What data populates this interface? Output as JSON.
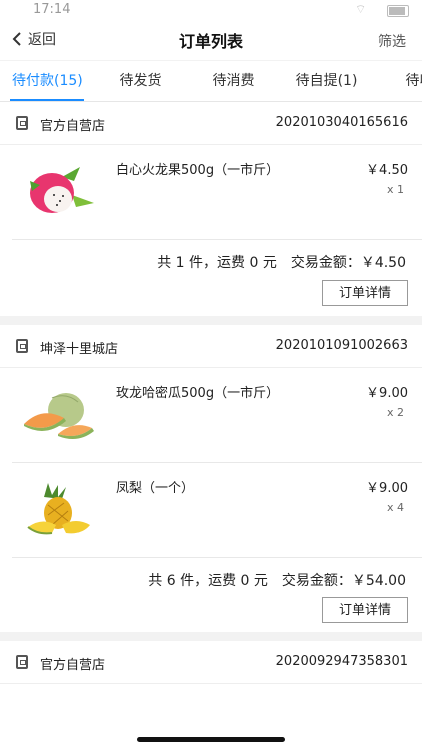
{
  "status": {
    "time": "17:14"
  },
  "navbar": {
    "back_label": "返回",
    "title": "订单列表",
    "filter_label": "筛选"
  },
  "tabs": [
    {
      "label": "待付款(15)"
    },
    {
      "label": "待发货"
    },
    {
      "label": "待消费"
    },
    {
      "label": "待自提(1)"
    },
    {
      "label": "待收"
    }
  ],
  "orders": [
    {
      "store": "官方自营店",
      "order_no": "2020103040165616",
      "items": [
        {
          "name": "白心火龙果500g（一市斤）",
          "price": "￥4.50",
          "qty": "x 1"
        }
      ],
      "summary": {
        "count_text": "共 1 件，运费 0 元",
        "amount_text": "交易金额：￥4.50"
      },
      "detail_label": "订单详情"
    },
    {
      "store": "坤泽十里城店",
      "order_no": "2020101091002663",
      "items": [
        {
          "name": "玫龙哈密瓜500g（一市斤）",
          "price": "￥9.00",
          "qty": "x 2"
        },
        {
          "name": "凤梨（一个）",
          "price": "￥9.00",
          "qty": "x 4"
        }
      ],
      "summary": {
        "count_text": "共 6 件，运费 0 元",
        "amount_text": "交易金额：￥54.00"
      },
      "detail_label": "订单详情"
    },
    {
      "store": "官方自营店",
      "order_no": "2020092947358301"
    }
  ]
}
